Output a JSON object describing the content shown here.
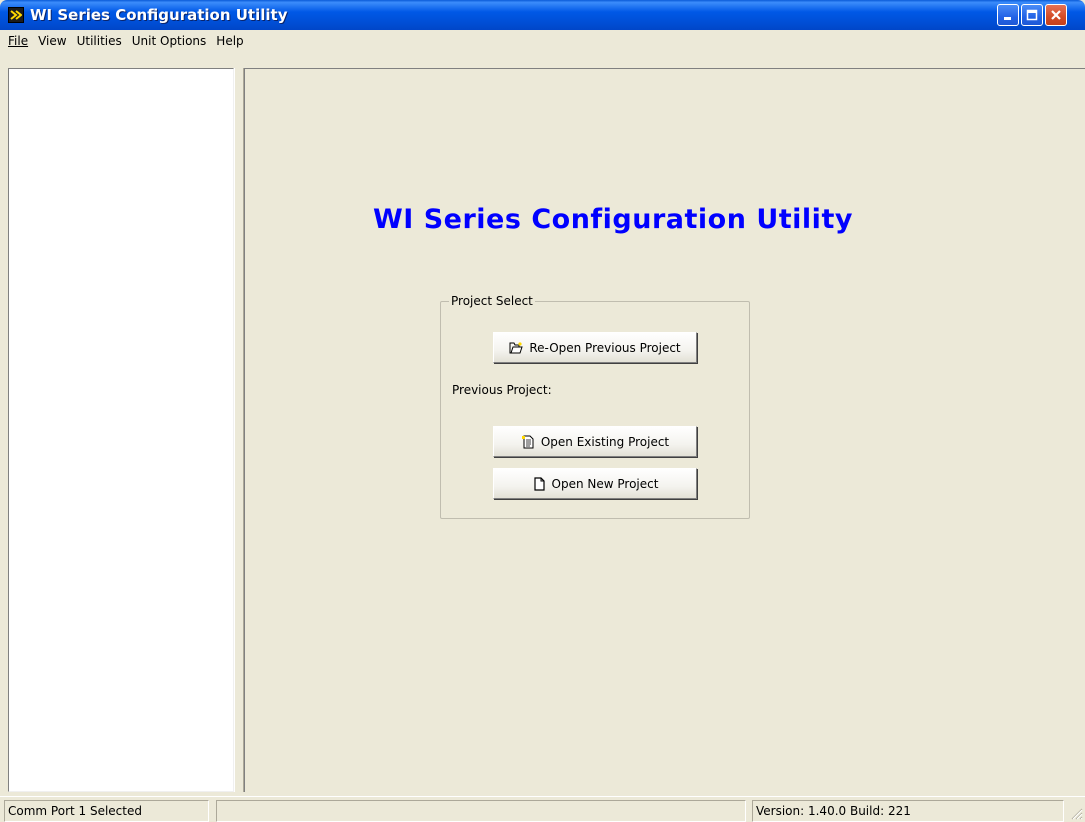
{
  "window": {
    "title": "WI Series Configuration Utility",
    "icon": "app-icon",
    "controls": [
      "minimize-icon",
      "maximize-icon",
      "close-icon"
    ],
    "colors": {
      "titlebar": "#0054e3",
      "close_button": "#d34b26"
    }
  },
  "menu": {
    "file": "File",
    "view": "View",
    "utilities": "Utilities",
    "unit_options": "Unit Options",
    "help": "Help"
  },
  "main": {
    "heading": "WI Series Configuration Utility",
    "heading_color": "#0000ff",
    "group": {
      "label": "Project Select",
      "reopen_button": "Re-Open Previous Project",
      "previous_project_label": "Previous Project:",
      "open_existing_button": "Open Existing Project",
      "open_new_button": "Open New Project"
    }
  },
  "status": {
    "comm_port": "Comm Port 1 Selected",
    "middle": "",
    "version": "Version: 1.40.0 Build: 221"
  }
}
